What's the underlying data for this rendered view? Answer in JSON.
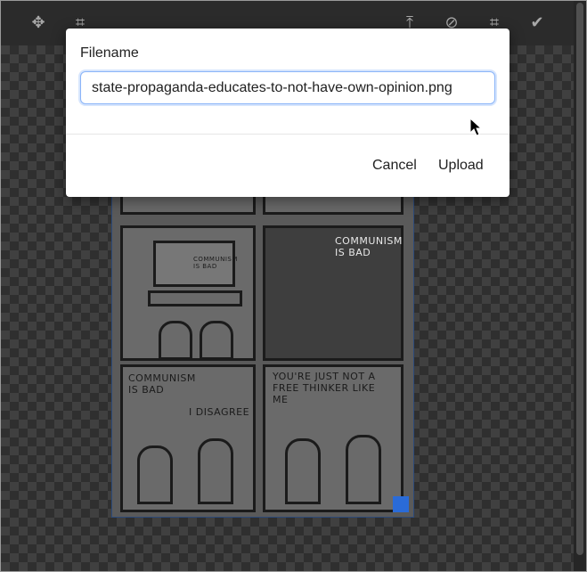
{
  "toolbar": {
    "left_tools": [
      {
        "icon": "move-icon",
        "glyph": "✥"
      },
      {
        "icon": "crop-icon",
        "glyph": "⌗"
      }
    ],
    "right_tools": [
      {
        "icon": "upload-icon",
        "glyph": "⤒"
      },
      {
        "icon": "cancel-icon",
        "glyph": "⊘"
      },
      {
        "icon": "crop-icon",
        "glyph": "⌗"
      },
      {
        "icon": "checkmark-icon",
        "glyph": "✔"
      }
    ]
  },
  "comic": {
    "panel_text_1": "COMMUNISM IS BAD",
    "tv_text": "COMMUNISM IS BAD",
    "panel_text_3a": "COMMUNISM IS BAD",
    "panel_text_3b": "I DISAGREE",
    "panel_text_4": "YOU'RE JUST NOT A FREE THINKER LIKE ME"
  },
  "dialog": {
    "label": "Filename",
    "filename_value": "state-propaganda-educates-to-not-have-own-opinion.png",
    "cancel_label": "Cancel",
    "upload_label": "Upload"
  },
  "colors": {
    "accent": "#2a6bd8",
    "input_focus": "#8ab4f8"
  }
}
